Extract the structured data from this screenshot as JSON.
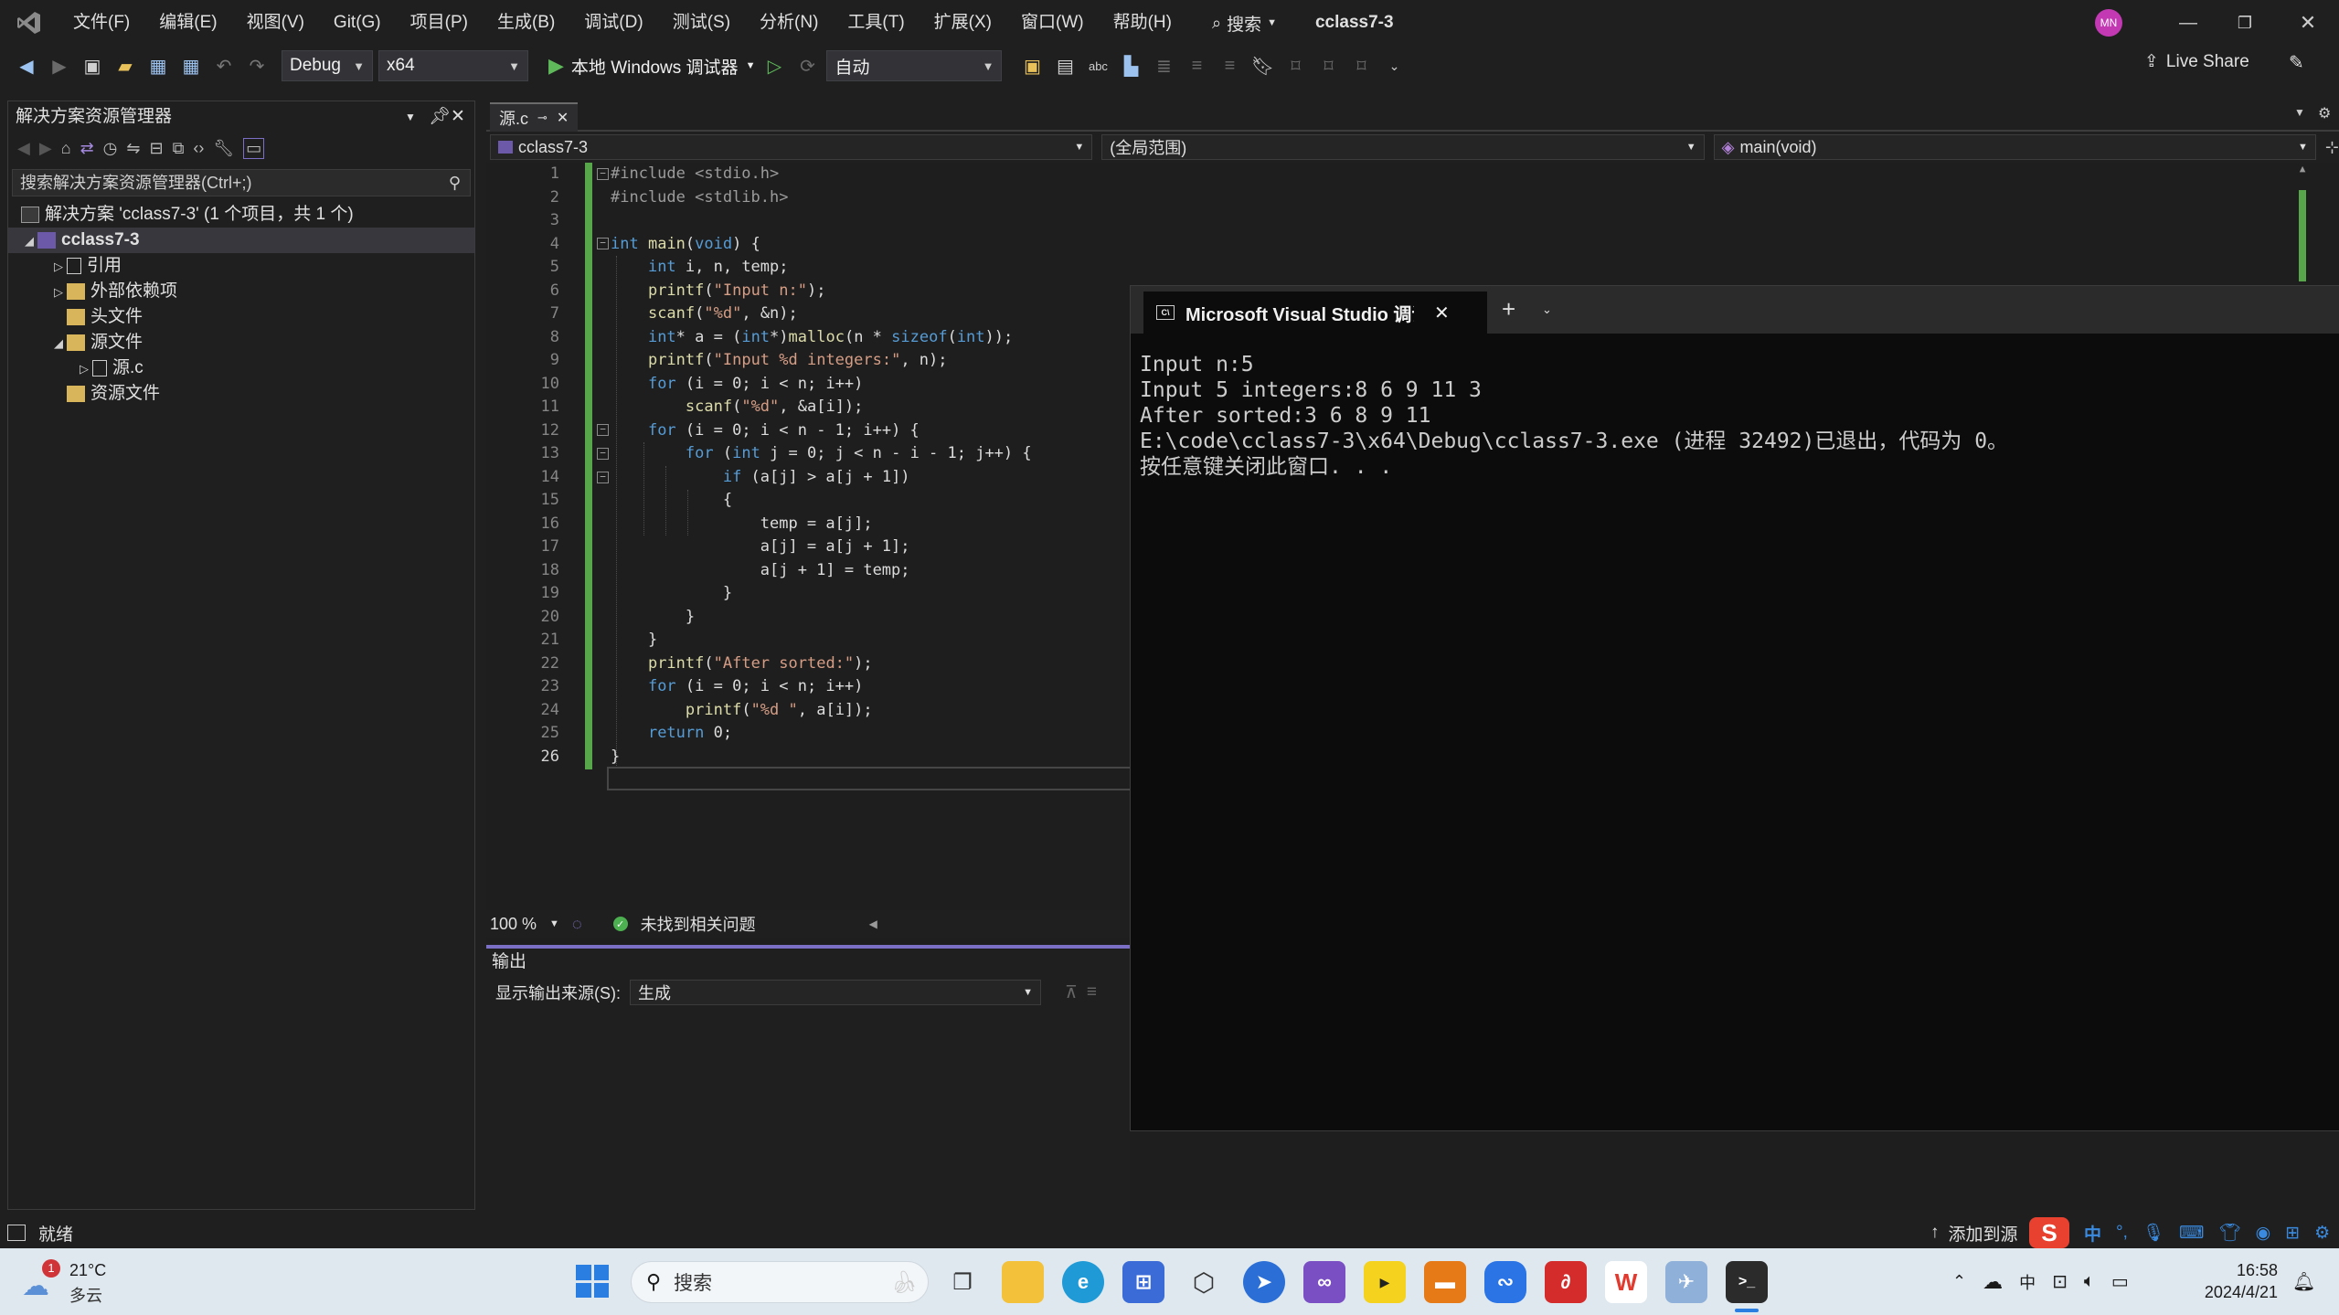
{
  "app": {
    "title": "cclass7-3",
    "user_initials": "MN",
    "live_share": "Live Share",
    "search_label": "搜索"
  },
  "menu": [
    "文件(F)",
    "编辑(E)",
    "视图(V)",
    "Git(G)",
    "项目(P)",
    "生成(B)",
    "调试(D)",
    "测试(S)",
    "分析(N)",
    "工具(T)",
    "扩展(X)",
    "窗口(W)",
    "帮助(H)"
  ],
  "toolbar": {
    "config": "Debug",
    "platform": "x64",
    "run_label": "本地 Windows 调试器",
    "auto": "自动"
  },
  "solution_explorer": {
    "title": "解决方案资源管理器",
    "search_placeholder": "搜索解决方案资源管理器(Ctrl+;)",
    "solution_label": "解决方案 'cclass7-3' (1 个项目，共 1 个)",
    "project": "cclass7-3",
    "items": [
      "引用",
      "外部依赖项",
      "头文件",
      "源文件",
      "源.c",
      "资源文件"
    ]
  },
  "editor": {
    "tab_name": "源.c",
    "nav_project": "cclass7-3",
    "nav_scope": "(全局范围)",
    "nav_function": "main(void)",
    "zoom": "100 %",
    "issues": "未找到相关问题",
    "line_numbers": [
      "1",
      "2",
      "3",
      "4",
      "5",
      "6",
      "7",
      "8",
      "9",
      "10",
      "11",
      "12",
      "13",
      "14",
      "15",
      "16",
      "17",
      "18",
      "19",
      "20",
      "21",
      "22",
      "23",
      "24",
      "25",
      "26"
    ],
    "lines": [
      "#include <stdio.h>",
      "#include <stdlib.h>",
      "",
      "int main(void) {",
      "    int i, n, temp;",
      "    printf(\"Input n:\");",
      "    scanf(\"%d\", &n);",
      "    int* a = (int*)malloc(n * sizeof(int));",
      "    printf(\"Input %d integers:\", n);",
      "    for (i = 0; i < n; i++)",
      "        scanf(\"%d\", &a[i]);",
      "    for (i = 0; i < n - 1; i++) {",
      "        for (int j = 0; j < n - i - 1; j++) {",
      "            if (a[j] > a[j + 1])",
      "            {",
      "                temp = a[j];",
      "                a[j] = a[j + 1];",
      "                a[j + 1] = temp;",
      "            }",
      "        }",
      "    }",
      "    printf(\"After sorted:\");",
      "    for (i = 0; i < n; i++)",
      "        printf(\"%d \", a[i]);",
      "    return 0;",
      "}"
    ]
  },
  "output": {
    "title": "输出",
    "source_label": "显示输出来源(S):",
    "source_value": "生成"
  },
  "terminal": {
    "tab_title": "Microsoft Visual Studio 调试",
    "lines": [
      "Input n:5",
      "Input 5 integers:8 6 9 11 3",
      "After sorted:3 6 8 9 11",
      "E:\\code\\cclass7-3\\x64\\Debug\\cclass7-3.exe (进程 32492)已退出，代码为 0。",
      "按任意键关闭此窗口. . ."
    ]
  },
  "status": {
    "ready": "就绪",
    "add_to_source": "添加到源"
  },
  "taskbar": {
    "weather_temp": "21°C",
    "weather_desc": "多云",
    "weather_badge": "1",
    "search": "搜索",
    "ime": "中",
    "time": "16:58",
    "date": "2024/4/21"
  },
  "colors": {
    "accent": "#7a6fc4",
    "green_bar": "#57a64a",
    "avatar": "#c239b3"
  }
}
